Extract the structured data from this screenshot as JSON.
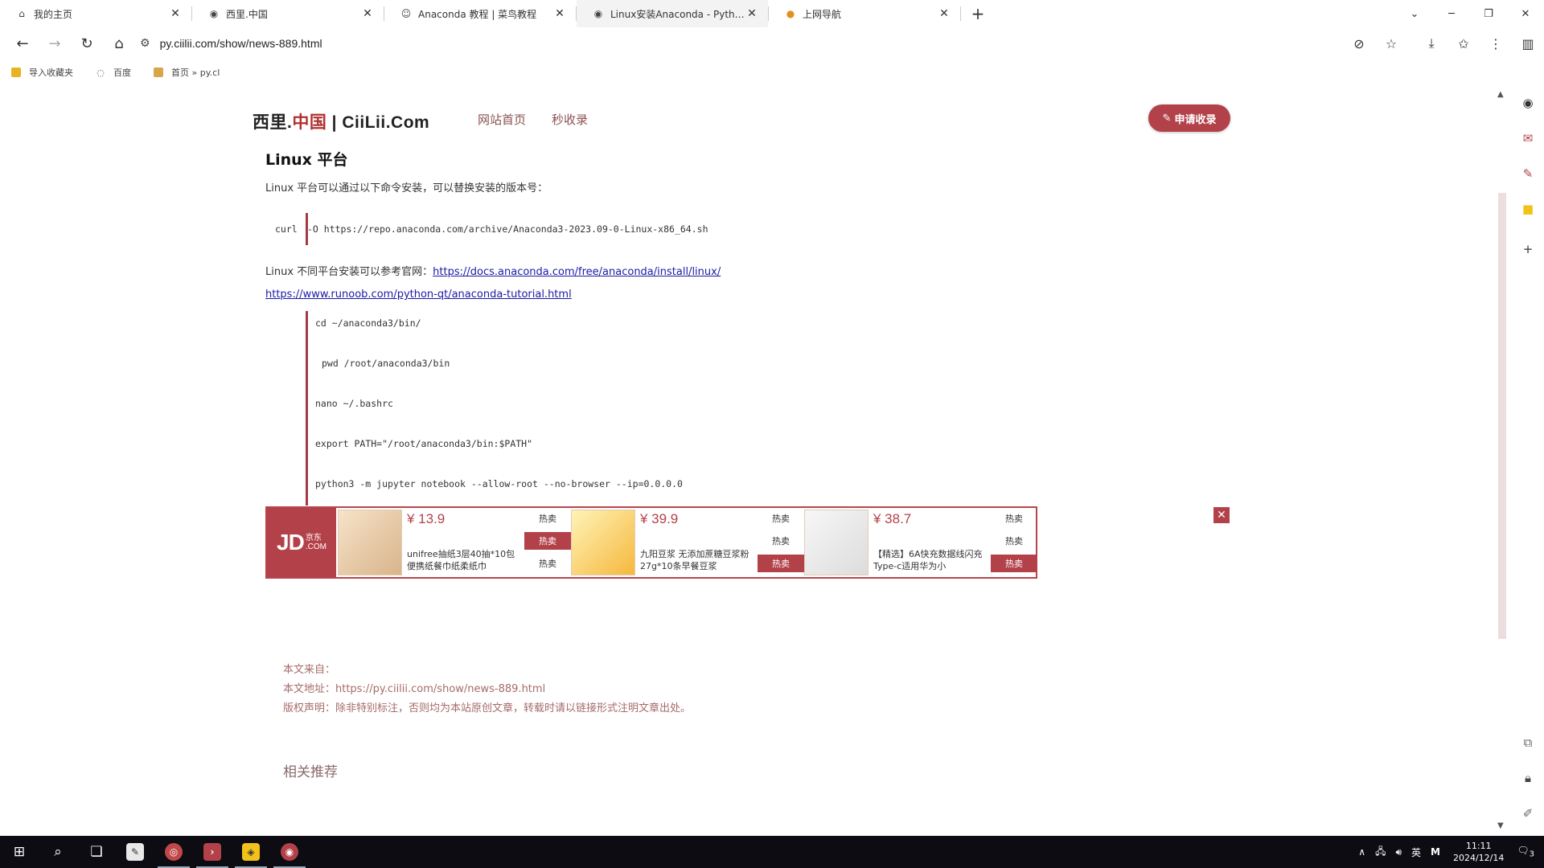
{
  "tabs": [
    {
      "title": "我的主页",
      "icon": "home-icon"
    },
    {
      "title": "西里.中国",
      "icon": "globe-icon"
    },
    {
      "title": "Anaconda 教程 | 菜鸟教程",
      "icon": "runoob-icon"
    },
    {
      "title": "Linux安装Anaconda - Python",
      "icon": "globe-icon"
    },
    {
      "title": "上网导航",
      "icon": "nav-icon"
    }
  ],
  "address": {
    "url": "py.ciilii.com/show/news-889.html"
  },
  "bookmarks": [
    {
      "label": "导入收藏夹",
      "icon": "folder-icon"
    },
    {
      "label": "百度",
      "icon": "baidu-icon"
    },
    {
      "label": "首页 » py.cl",
      "icon": "page-icon"
    }
  ],
  "site": {
    "logo_prefix": "西里.",
    "logo_red": "中国",
    "logo_suffix": " | CiiLii.Com",
    "nav": [
      "网站首页",
      "秒收录"
    ],
    "apply_label": "申请收录"
  },
  "article": {
    "heading": "Linux 平台",
    "intro": "Linux 平台可以通过以下命令安装，可以替换安装的版本号：",
    "code_curl_cmd": "curl",
    "code_curl_args": "-O https://repo.anaconda.com/archive/Anaconda3-2023.09-0-Linux-x86_64.sh",
    "ref_prefix": "Linux 不同平台安装可以参考官网：",
    "ref_link": "https://docs.anaconda.com/free/anaconda/install/linux/",
    "runoob_link": "https://www.runoob.com/python-qt/anaconda-tutorial.html",
    "code_lines": [
      "cd ~/anaconda3/bin/",
      "pwd /root/anaconda3/bin",
      "nano ~/.bashrc",
      "export PATH=\"/root/anaconda3/bin:$PATH\"",
      "python3 -m jupyter notebook --allow-root --no-browser --ip=0.0.0.0"
    ]
  },
  "ad": {
    "logo_main": "JD",
    "logo_cn": "京东",
    "logo_com": ".COM",
    "hot_label": "热卖",
    "items": [
      {
        "price": "¥ 13.9",
        "desc": "unifree抽纸3层40抽*10包便携纸餐巾纸柔纸巾"
      },
      {
        "price": "¥ 39.9",
        "desc": "九阳豆浆 无添加蔗糖豆浆粉27g*10条早餐豆浆"
      },
      {
        "price": "¥ 38.7",
        "desc": "【精选】6A快充数据线闪充Type-c适用华为小"
      }
    ]
  },
  "source": {
    "from_label": "本文来自：",
    "url_label": "本文地址：https://py.ciilii.com/show/news-889.html",
    "copyright": "版权声明：除非特别标注，否则均为本站原创文章，转载时请以链接形式注明文章出处。"
  },
  "related": "相关推荐",
  "taskbar": {
    "time": "11:11",
    "date": "2024/12/14",
    "ime": "英",
    "notif_count": "3"
  }
}
